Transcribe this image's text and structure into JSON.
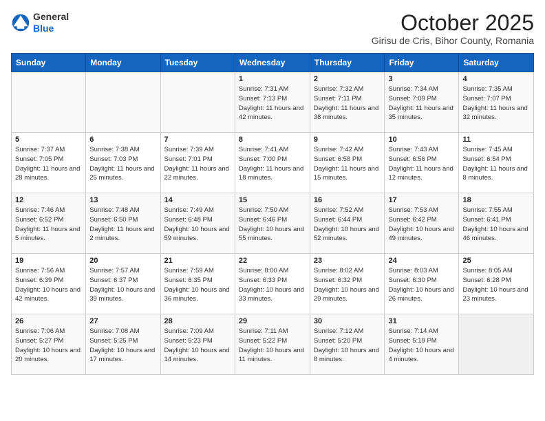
{
  "header": {
    "logo_general": "General",
    "logo_blue": "Blue",
    "month_title": "October 2025",
    "location": "Girisu de Cris, Bihor County, Romania"
  },
  "weekdays": [
    "Sunday",
    "Monday",
    "Tuesday",
    "Wednesday",
    "Thursday",
    "Friday",
    "Saturday"
  ],
  "weeks": [
    [
      {
        "day": "",
        "sunrise": "",
        "sunset": "",
        "daylight": "",
        "empty": true
      },
      {
        "day": "",
        "sunrise": "",
        "sunset": "",
        "daylight": "",
        "empty": true
      },
      {
        "day": "",
        "sunrise": "",
        "sunset": "",
        "daylight": "",
        "empty": true
      },
      {
        "day": "1",
        "sunrise": "Sunrise: 7:31 AM",
        "sunset": "Sunset: 7:13 PM",
        "daylight": "Daylight: 11 hours and 42 minutes."
      },
      {
        "day": "2",
        "sunrise": "Sunrise: 7:32 AM",
        "sunset": "Sunset: 7:11 PM",
        "daylight": "Daylight: 11 hours and 38 minutes."
      },
      {
        "day": "3",
        "sunrise": "Sunrise: 7:34 AM",
        "sunset": "Sunset: 7:09 PM",
        "daylight": "Daylight: 11 hours and 35 minutes."
      },
      {
        "day": "4",
        "sunrise": "Sunrise: 7:35 AM",
        "sunset": "Sunset: 7:07 PM",
        "daylight": "Daylight: 11 hours and 32 minutes."
      }
    ],
    [
      {
        "day": "5",
        "sunrise": "Sunrise: 7:37 AM",
        "sunset": "Sunset: 7:05 PM",
        "daylight": "Daylight: 11 hours and 28 minutes."
      },
      {
        "day": "6",
        "sunrise": "Sunrise: 7:38 AM",
        "sunset": "Sunset: 7:03 PM",
        "daylight": "Daylight: 11 hours and 25 minutes."
      },
      {
        "day": "7",
        "sunrise": "Sunrise: 7:39 AM",
        "sunset": "Sunset: 7:01 PM",
        "daylight": "Daylight: 11 hours and 22 minutes."
      },
      {
        "day": "8",
        "sunrise": "Sunrise: 7:41 AM",
        "sunset": "Sunset: 7:00 PM",
        "daylight": "Daylight: 11 hours and 18 minutes."
      },
      {
        "day": "9",
        "sunrise": "Sunrise: 7:42 AM",
        "sunset": "Sunset: 6:58 PM",
        "daylight": "Daylight: 11 hours and 15 minutes."
      },
      {
        "day": "10",
        "sunrise": "Sunrise: 7:43 AM",
        "sunset": "Sunset: 6:56 PM",
        "daylight": "Daylight: 11 hours and 12 minutes."
      },
      {
        "day": "11",
        "sunrise": "Sunrise: 7:45 AM",
        "sunset": "Sunset: 6:54 PM",
        "daylight": "Daylight: 11 hours and 8 minutes."
      }
    ],
    [
      {
        "day": "12",
        "sunrise": "Sunrise: 7:46 AM",
        "sunset": "Sunset: 6:52 PM",
        "daylight": "Daylight: 11 hours and 5 minutes."
      },
      {
        "day": "13",
        "sunrise": "Sunrise: 7:48 AM",
        "sunset": "Sunset: 6:50 PM",
        "daylight": "Daylight: 11 hours and 2 minutes."
      },
      {
        "day": "14",
        "sunrise": "Sunrise: 7:49 AM",
        "sunset": "Sunset: 6:48 PM",
        "daylight": "Daylight: 10 hours and 59 minutes."
      },
      {
        "day": "15",
        "sunrise": "Sunrise: 7:50 AM",
        "sunset": "Sunset: 6:46 PM",
        "daylight": "Daylight: 10 hours and 55 minutes."
      },
      {
        "day": "16",
        "sunrise": "Sunrise: 7:52 AM",
        "sunset": "Sunset: 6:44 PM",
        "daylight": "Daylight: 10 hours and 52 minutes."
      },
      {
        "day": "17",
        "sunrise": "Sunrise: 7:53 AM",
        "sunset": "Sunset: 6:42 PM",
        "daylight": "Daylight: 10 hours and 49 minutes."
      },
      {
        "day": "18",
        "sunrise": "Sunrise: 7:55 AM",
        "sunset": "Sunset: 6:41 PM",
        "daylight": "Daylight: 10 hours and 46 minutes."
      }
    ],
    [
      {
        "day": "19",
        "sunrise": "Sunrise: 7:56 AM",
        "sunset": "Sunset: 6:39 PM",
        "daylight": "Daylight: 10 hours and 42 minutes."
      },
      {
        "day": "20",
        "sunrise": "Sunrise: 7:57 AM",
        "sunset": "Sunset: 6:37 PM",
        "daylight": "Daylight: 10 hours and 39 minutes."
      },
      {
        "day": "21",
        "sunrise": "Sunrise: 7:59 AM",
        "sunset": "Sunset: 6:35 PM",
        "daylight": "Daylight: 10 hours and 36 minutes."
      },
      {
        "day": "22",
        "sunrise": "Sunrise: 8:00 AM",
        "sunset": "Sunset: 6:33 PM",
        "daylight": "Daylight: 10 hours and 33 minutes."
      },
      {
        "day": "23",
        "sunrise": "Sunrise: 8:02 AM",
        "sunset": "Sunset: 6:32 PM",
        "daylight": "Daylight: 10 hours and 29 minutes."
      },
      {
        "day": "24",
        "sunrise": "Sunrise: 8:03 AM",
        "sunset": "Sunset: 6:30 PM",
        "daylight": "Daylight: 10 hours and 26 minutes."
      },
      {
        "day": "25",
        "sunrise": "Sunrise: 8:05 AM",
        "sunset": "Sunset: 6:28 PM",
        "daylight": "Daylight: 10 hours and 23 minutes."
      }
    ],
    [
      {
        "day": "26",
        "sunrise": "Sunrise: 7:06 AM",
        "sunset": "Sunset: 5:27 PM",
        "daylight": "Daylight: 10 hours and 20 minutes."
      },
      {
        "day": "27",
        "sunrise": "Sunrise: 7:08 AM",
        "sunset": "Sunset: 5:25 PM",
        "daylight": "Daylight: 10 hours and 17 minutes."
      },
      {
        "day": "28",
        "sunrise": "Sunrise: 7:09 AM",
        "sunset": "Sunset: 5:23 PM",
        "daylight": "Daylight: 10 hours and 14 minutes."
      },
      {
        "day": "29",
        "sunrise": "Sunrise: 7:11 AM",
        "sunset": "Sunset: 5:22 PM",
        "daylight": "Daylight: 10 hours and 11 minutes."
      },
      {
        "day": "30",
        "sunrise": "Sunrise: 7:12 AM",
        "sunset": "Sunset: 5:20 PM",
        "daylight": "Daylight: 10 hours and 8 minutes."
      },
      {
        "day": "31",
        "sunrise": "Sunrise: 7:14 AM",
        "sunset": "Sunset: 5:19 PM",
        "daylight": "Daylight: 10 hours and 4 minutes."
      },
      {
        "day": "",
        "sunrise": "",
        "sunset": "",
        "daylight": "",
        "empty": true
      }
    ]
  ]
}
